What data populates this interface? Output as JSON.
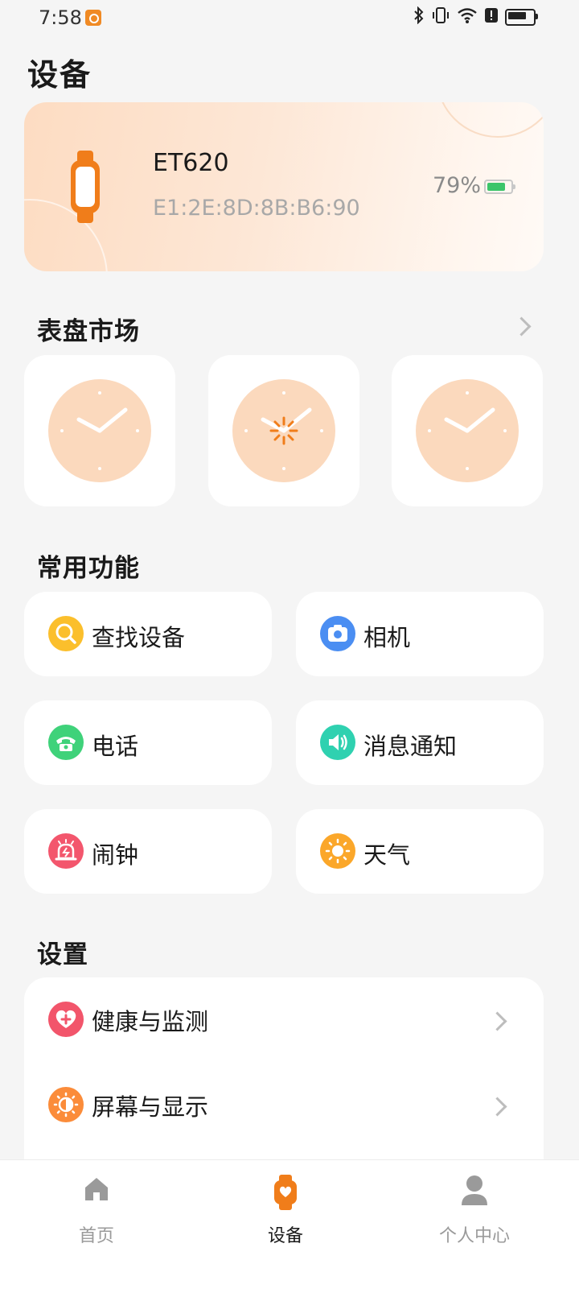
{
  "status_bar": {
    "time": "7:58"
  },
  "page": {
    "title": "设备"
  },
  "device": {
    "name": "ET620",
    "mac": "E1:2E:8D:8B:B6:90",
    "battery": "79%",
    "battery_color": "#3cc56a",
    "accent": "#f07d1a"
  },
  "watch_faces": {
    "title": "表盘市场",
    "count": 3,
    "face_color": "#fbd9bd"
  },
  "functions": {
    "title": "常用功能",
    "items": [
      {
        "label": "查找设备",
        "icon": "search-icon",
        "color": "#fbbf2c"
      },
      {
        "label": "相机",
        "icon": "camera-icon",
        "color": "#4b8ef2"
      },
      {
        "label": "电话",
        "icon": "phone-icon",
        "color": "#3fd27a"
      },
      {
        "label": "消息通知",
        "icon": "speaker-icon",
        "color": "#2fd1b0"
      },
      {
        "label": "闹钟",
        "icon": "alarm-icon",
        "color": "#f3566d"
      },
      {
        "label": "天气",
        "icon": "sun-icon",
        "color": "#fba72a"
      }
    ]
  },
  "settings": {
    "title": "设置",
    "items": [
      {
        "label": "健康与监测",
        "icon": "health-heart-icon",
        "color": "#f2556b"
      },
      {
        "label": "屏幕与显示",
        "icon": "brightness-icon",
        "color": "#fb8c3a"
      }
    ]
  },
  "bottom_nav": {
    "items": [
      {
        "label": "首页",
        "icon": "home-icon",
        "active": false
      },
      {
        "label": "设备",
        "icon": "watch-icon",
        "active": true
      },
      {
        "label": "个人中心",
        "icon": "user-icon",
        "active": false
      }
    ]
  }
}
